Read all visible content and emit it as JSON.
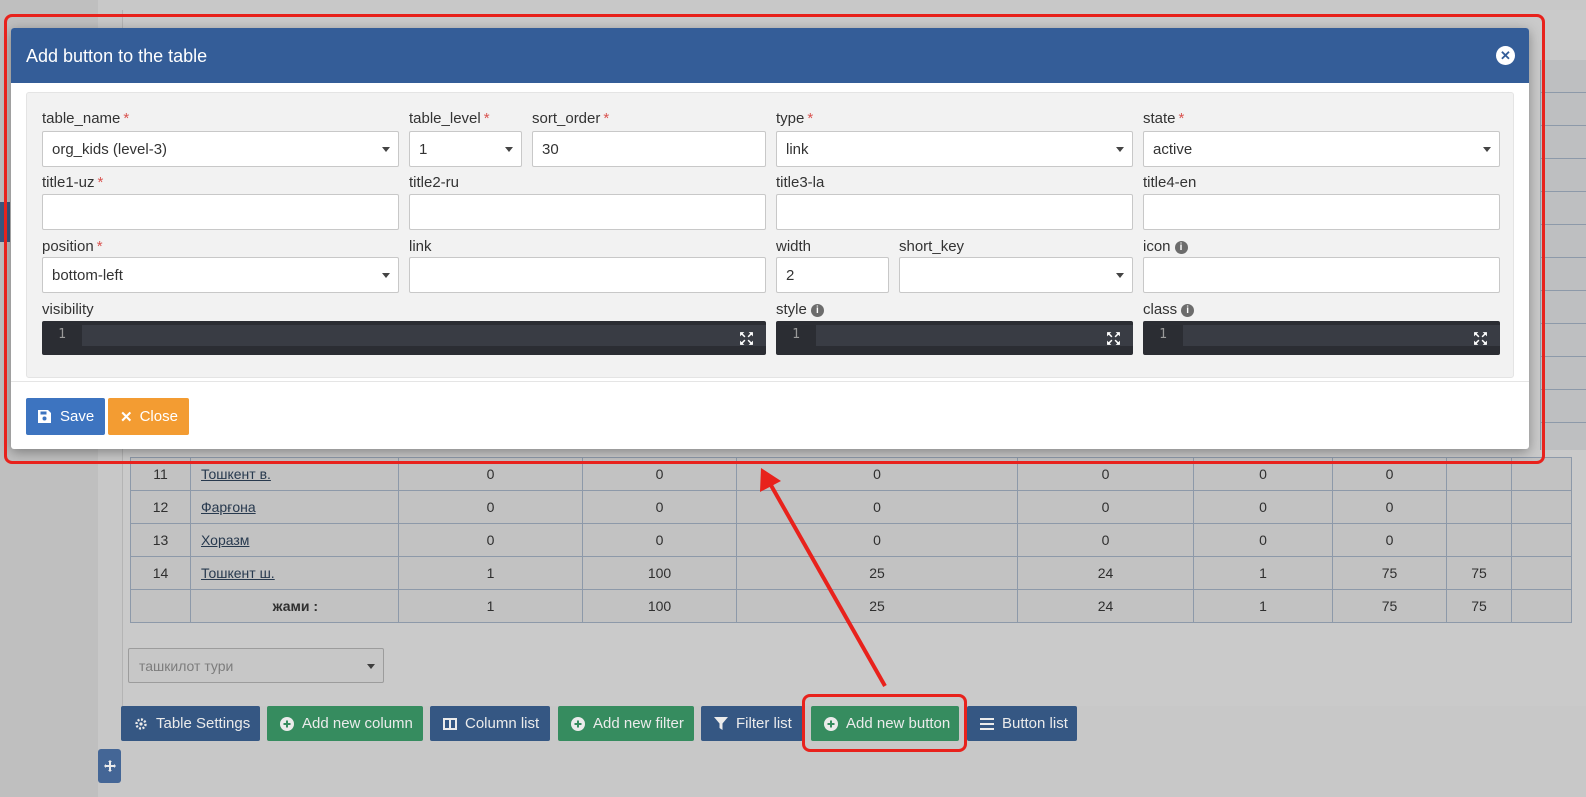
{
  "background": {
    "table_rows": [
      {
        "no": "11",
        "name": "Тошкент в.",
        "c1": "0",
        "c2": "0",
        "c3": "0",
        "c4": "0",
        "c5": "0",
        "c6": "0",
        "c7": ""
      },
      {
        "no": "12",
        "name": "Фарғона",
        "c1": "0",
        "c2": "0",
        "c3": "0",
        "c4": "0",
        "c5": "0",
        "c6": "0",
        "c7": ""
      },
      {
        "no": "13",
        "name": "Хоразм",
        "c1": "0",
        "c2": "0",
        "c3": "0",
        "c4": "0",
        "c5": "0",
        "c6": "0",
        "c7": ""
      },
      {
        "no": "14",
        "name": "Тошкент ш.",
        "c1": "1",
        "c2": "100",
        "c3": "25",
        "c4": "24",
        "c5": "1",
        "c6": "75",
        "c7": "75"
      }
    ],
    "total_row": {
      "label": "жами :",
      "c1": "1",
      "c2": "100",
      "c3": "25",
      "c4": "24",
      "c5": "1",
      "c6": "75",
      "c7": "75"
    },
    "org_type_select": {
      "placeholder": "ташкилот тури"
    }
  },
  "toolbar": {
    "table_settings": "Table Settings",
    "add_new_column": "Add new column",
    "column_list": "Column list",
    "add_new_filter": "Add new filter",
    "filter_list": "Filter list",
    "add_new_button": "Add new button",
    "button_list": "Button list"
  },
  "modal": {
    "title": "Add button to the table",
    "fields": {
      "table_name": {
        "label": "table_name",
        "value": "org_kids (level-3)"
      },
      "table_level": {
        "label": "table_level",
        "value": "1"
      },
      "sort_order": {
        "label": "sort_order",
        "value": "30"
      },
      "type": {
        "label": "type",
        "value": "link"
      },
      "state": {
        "label": "state",
        "value": "active"
      },
      "title1": {
        "label": "title1-uz",
        "value": ""
      },
      "title2": {
        "label": "title2-ru",
        "value": ""
      },
      "title3": {
        "label": "title3-la",
        "value": ""
      },
      "title4": {
        "label": "title4-en",
        "value": ""
      },
      "position": {
        "label": "position",
        "value": "bottom-left"
      },
      "link": {
        "label": "link",
        "value": ""
      },
      "width": {
        "label": "width",
        "value": "2"
      },
      "short_key": {
        "label": "short_key",
        "value": ""
      },
      "icon": {
        "label": "icon",
        "value": ""
      },
      "visibility": {
        "label": "visibility",
        "line": "1"
      },
      "style": {
        "label": "style",
        "line": "1"
      },
      "class": {
        "label": "class",
        "line": "1"
      }
    },
    "required_mark": "*",
    "save": "Save",
    "close": "Close"
  },
  "colors": {
    "modal_header": "#345d98",
    "annotation": "#e8221c",
    "save_button": "#3d74c0",
    "close_button": "#f39c32",
    "toolbar_blue": "#3a5f8f",
    "toolbar_green": "#3b9868"
  }
}
